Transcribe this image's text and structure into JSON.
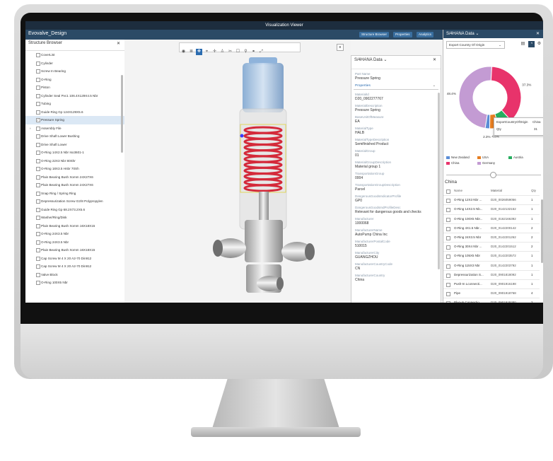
{
  "window_title": "Visualization Viewer",
  "app": {
    "name": "Evovalve_Design",
    "buttons": [
      "Structure Browser",
      "Properties",
      "Analytics"
    ]
  },
  "structure_browser": {
    "title": "Structure Browser",
    "items": [
      "CoverList",
      "Cylinder",
      "Screw In Bearing",
      "O-Ring",
      "Piston",
      "Cylinder Seal Pvc1 106.4X129X4.5 Nbr",
      "Tubing",
      "Guide Ring Gp 124X129X5.6",
      "Pressure Spring",
      "Assembly File",
      "Drive Shaft Lower Bushing",
      "Drive Shaft Lower",
      "O-Ring 14X2.5 Nbr Iso3601-1",
      "O-Ring 22X3 Nbr 80Shr",
      "O-Ring 18X3.5 Hnbr 70Sh",
      "Plain Bearing Bush Xomm 24X27X6",
      "Plain Bearing Bush Xomm 24X27X6",
      "Snap Ring / Spring Ring",
      "Depressurization Screw G2/8 Polypropylen",
      "Guide Ring Gp 68.2X73.2X5.6",
      "Washer/Ring/Disk",
      "Plain Bearing Bush Xomm 16X18X15",
      "O-Ring 24X3.5 Nbr",
      "O-Ring 24X3.5 Nbr",
      "Plain Bearing Bush Xomm 16X18X15",
      "Cap Screw M 4 X 20 A2-70 Din912",
      "Cap Screw M 4 X 20 A2-70 Din912",
      "Valve Block",
      "O-Ring 100X5 Nbr"
    ],
    "selected_index": 8
  },
  "viewer_toolbar": [
    "eye",
    "list",
    "move",
    "target",
    "cross",
    "person",
    "scissors",
    "box",
    "pin",
    "link",
    "expand"
  ],
  "details_panel": {
    "title": "S/4HANA Data",
    "part_name_label": "Part Name",
    "part_name": "Pressure Spring",
    "section": "Properties",
    "fields": [
      {
        "label": "MaterialId",
        "value": "D20_0902277767"
      },
      {
        "label": "MaterialDescription",
        "value": "Pressure Spring"
      },
      {
        "label": "BaseUnitOfMeasure",
        "value": "EA"
      },
      {
        "label": "MaterialType",
        "value": "HALB"
      },
      {
        "label": "MaterialTypeDescription",
        "value": "Semifinished Product"
      },
      {
        "label": "MaterialGroup",
        "value": "01"
      },
      {
        "label": "MaterialGroupDescription",
        "value": "Material group 1"
      },
      {
        "label": "TransportationGroup",
        "value": "0004"
      },
      {
        "label": "TransportationGroupDescription",
        "value": "Parcel"
      },
      {
        "label": "DangerousGoodsIndicatorProfile",
        "value": "GP0"
      },
      {
        "label": "DangerousGoodsIndProfileDesc",
        "value": "Relevant for dangerous goods and checks"
      },
      {
        "label": "Manufacturer",
        "value": "1000068"
      },
      {
        "label": "ManufacturerName",
        "value": "AutoPump China Inc"
      },
      {
        "label": "ManufacturerPostalCode",
        "value": "510015"
      },
      {
        "label": "ManufacturerCity",
        "value": "GUANGZHOU"
      },
      {
        "label": "ManufacturerCountryCode",
        "value": "CN"
      },
      {
        "label": "ManufacturerCountry",
        "value": "China"
      }
    ]
  },
  "right_panel": {
    "title": "S/4HANA Data",
    "filter": "Export Country Of Origin",
    "chart_data": {
      "type": "pie",
      "categories": [
        "Germany",
        "China",
        "New Zealand",
        "USA",
        "Austria"
      ],
      "values": [
        48.4,
        37.3,
        7.2,
        4.8,
        2.3
      ],
      "labels": [
        "48.4%",
        "37.3%",
        "7.2%",
        "4.8%",
        "2.3%"
      ],
      "colors": [
        "#c39bd3",
        "#e8336b",
        "#27ae60",
        "#e67e22",
        "#5b8dd6"
      ],
      "donut": true,
      "legend": [
        "New Zealand",
        "USA",
        "Austria",
        "China",
        "Germany"
      ],
      "legend_colors": [
        "#5b8dd6",
        "#e67e22",
        "#27ae60",
        "#e8336b",
        "#c39bd3"
      ],
      "legend_position": "bottom"
    },
    "tooltip": {
      "header": "ExportCountryOfOrigin",
      "header_value": "China",
      "row_label": "Qty",
      "row_value": "31"
    },
    "table": {
      "title": "China",
      "columns": [
        "Name",
        "Material",
        "Qty"
      ],
      "rows": [
        [
          "O-Ring 12X3 Nbr ...",
          "D20_0026059056",
          "1"
        ],
        [
          "O-Ring 14X2.5 Nb...",
          "D20_0142132152",
          "1"
        ],
        [
          "O-Ring 100X5 Nbr...",
          "D20_0162166392",
          "1"
        ],
        [
          "O-Ring 4X1.5 Nbr...",
          "D20_0142200142",
          "2"
        ],
        [
          "O-Ring 24X3.5 Nbr",
          "D20_0142201262",
          "2"
        ],
        [
          "O-Ring 30X4 Nbr ...",
          "D20_0142201512",
          "2"
        ],
        [
          "O-Ring 105X5 Nbr",
          "D20_0142203572",
          "1"
        ],
        [
          "O-Ring 115X3 Nbr",
          "D20_0142203792",
          "1"
        ],
        [
          "Depressurization S...",
          "D20_0901818092",
          "1"
        ],
        [
          "Push-In Lconnecti...",
          "D20_0901916198",
          "1"
        ],
        [
          "Pipe",
          "D20_0901918768",
          "4"
        ],
        [
          "Plug-In Connectio...",
          "D20_0901929380",
          "2"
        ],
        [
          "Washer/Ring/Disk",
          "D20_0902080349",
          "1"
        ],
        [
          "Washer/Ring/Disk",
          "D20_0902176433",
          "1"
        ]
      ]
    }
  }
}
